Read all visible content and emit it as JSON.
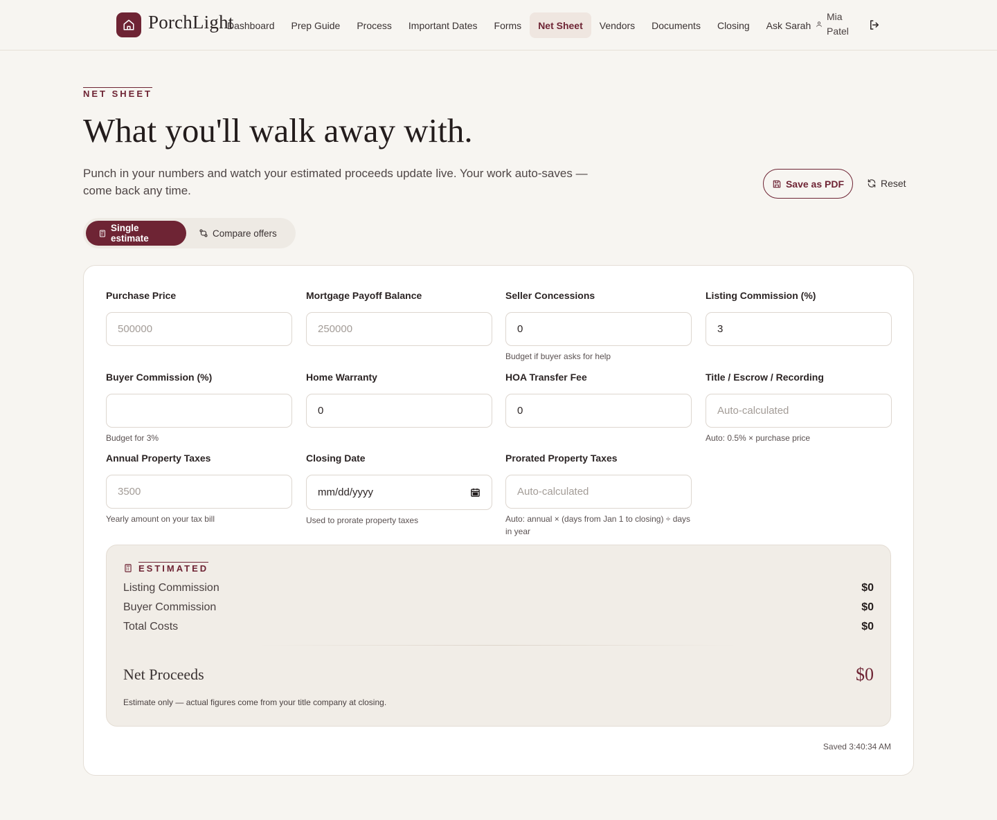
{
  "brand": {
    "name": "PorchLight",
    "accent": "#6e2434"
  },
  "nav": {
    "items": [
      {
        "label": "Dashboard"
      },
      {
        "label": "Prep Guide"
      },
      {
        "label": "Process"
      },
      {
        "label": "Important Dates"
      },
      {
        "label": "Forms"
      },
      {
        "label": "Net Sheet",
        "active": true
      },
      {
        "label": "Vendors"
      },
      {
        "label": "Documents"
      },
      {
        "label": "Closing"
      },
      {
        "label": "Ask Sarah"
      }
    ],
    "user": {
      "name": "Mia Patel",
      "icon": "user-icon"
    },
    "logout_icon": "logout-icon"
  },
  "hero": {
    "eyebrow": "NET SHEET",
    "title": "What you'll walk away with.",
    "subtitle": "Punch in your numbers and watch your estimated proceeds update live. Your work auto-saves — come back any time.",
    "save_pdf": "Save as PDF",
    "reset": "Reset"
  },
  "mode": {
    "single": "Single estimate",
    "compare": "Compare offers",
    "selected": "single"
  },
  "form": {
    "purchase_price": {
      "label": "Purchase Price",
      "value": "",
      "placeholder": "500000"
    },
    "mortgage_payoff": {
      "label": "Mortgage Payoff Balance",
      "value": "",
      "placeholder": "250000"
    },
    "seller_concessions": {
      "label": "Seller Concessions",
      "value": "0",
      "help": "Budget if buyer asks for help"
    },
    "listing_commission": {
      "label": "Listing Commission (%)",
      "value": "3"
    },
    "buyer_commission": {
      "label": "Buyer Commission (%)",
      "value": "",
      "help": "Budget for 3%"
    },
    "home_warranty": {
      "label": "Home Warranty",
      "value": "0"
    },
    "hoa_transfer": {
      "label": "HOA Transfer Fee",
      "value": "0"
    },
    "title_escrow": {
      "label": "Title / Escrow / Recording",
      "value": "",
      "placeholder": "Auto-calculated",
      "help": "Auto: 0.5% × purchase price"
    },
    "annual_taxes": {
      "label": "Annual Property Taxes",
      "value": "",
      "placeholder": "3500",
      "help": "Yearly amount on your tax bill"
    },
    "closing_date": {
      "label": "Closing Date",
      "value": "mm/dd/yyyy",
      "help": "Used to prorate property taxes"
    },
    "prorated_taxes": {
      "label": "Prorated Property Taxes",
      "value": "",
      "placeholder": "Auto-calculated",
      "help": "Auto: annual × (days from Jan 1 to closing) ÷ days in year"
    }
  },
  "estimate": {
    "heading": "ESTIMATED",
    "rows": [
      {
        "label": "Listing Commission",
        "value": "$0"
      },
      {
        "label": "Buyer Commission",
        "value": "$0"
      },
      {
        "label": "Total Costs",
        "value": "$0"
      }
    ],
    "net_label": "Net Proceeds",
    "net_value": "$0",
    "note": "Estimate only — actual figures come from your title company at closing."
  },
  "saved_status": "Saved 3:40:34 AM"
}
